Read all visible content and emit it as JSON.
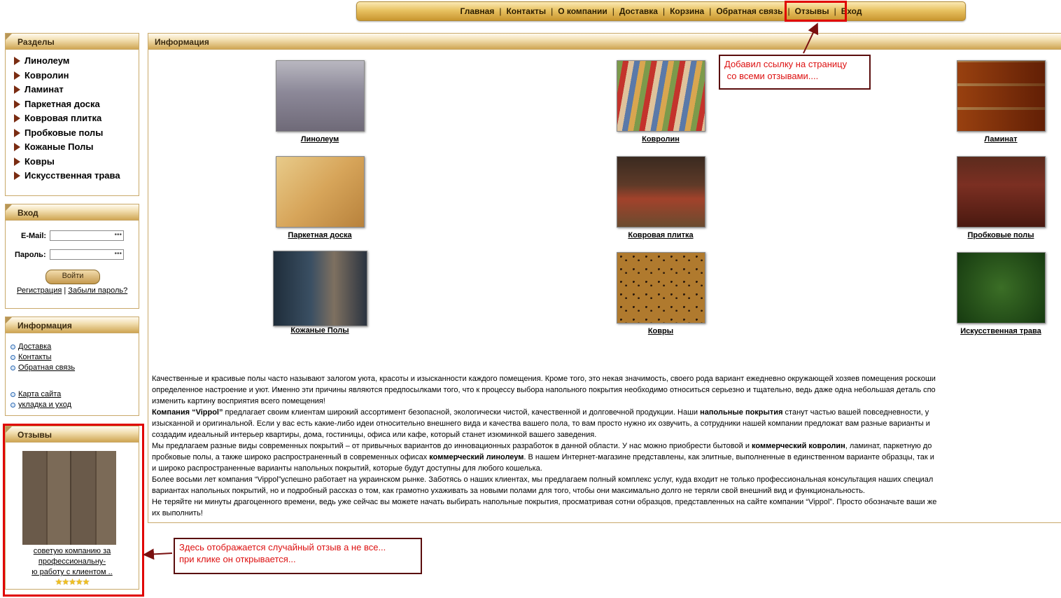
{
  "topnav": {
    "items": [
      "Главная",
      "Контакты",
      "О компании",
      "Доставка",
      "Корзина",
      "Обратная связь",
      "Отзывы",
      "Вход"
    ],
    "separator": "|"
  },
  "sidebar": {
    "sections": {
      "title": "Разделы",
      "items": [
        "Линолеум",
        "Ковролин",
        "Ламинат",
        "Паркетная доска",
        "Ковровая плитка",
        "Пробковые полы",
        "Кожаные Полы",
        "Ковры",
        "Искусственная трава"
      ]
    },
    "login": {
      "title": "Вход",
      "email_label": "E-Mail:",
      "password_label": "Пароль:",
      "email_value": "•••",
      "password_value": "•••",
      "button": "Войти",
      "register": "Регистрация",
      "divider": "|",
      "forgot": "Забыли пароль?"
    },
    "info": {
      "title": "Информация",
      "links": [
        "Доставка",
        "Контакты",
        "Обратная связь"
      ],
      "links2": [
        "Карта сайта",
        "укладка и уход"
      ]
    },
    "reviews": {
      "title": "Отзывы",
      "snippet_lines": [
        "советую компанию за",
        "профессиональну-",
        "ю работу с клиентом .."
      ],
      "stars": "★★★★★",
      "rating": 5
    }
  },
  "main": {
    "title": "Информация",
    "products": [
      "Линолеум",
      "Ковролин",
      "Ламинат",
      "Паркетная доска",
      "Ковровая плитка",
      "Пробковые полы",
      "Кожаные Полы",
      "Ковры",
      "Искусственная трава"
    ],
    "text": {
      "p1a": "Качественные и красивые полы часто называют залогом уюта, красоты и изысканности каждого помещения. Кроме того, это некая значимость, своего рода вариант ежедневно окружающей хозяев помещения роскоши",
      "p1b": "определенное настроение и уют. Именно эти причины являются предпосылками того, что к процессу выбора напольного покрытия необходимо относиться серьезно и тщательно, ведь даже одна небольшая деталь спо",
      "p1c": "изменить картину восприятия всего помещения!",
      "p2_bold1": "Компания “Vippol”",
      "p2a": " предлагает своим клиентам широкий ассортимент безопасной, экологически чистой, качественной и долговечной продукции. Наши ",
      "p2_bold2": "напольные покрытия",
      "p2b": " станут частью вашей повседневности, у",
      "p2c": "изысканной и оригинальной. Если у вас есть какие-либо идеи относительно внешнего вида и качества вашего пола, то вам просто нужно их озвучить, а сотрудники нашей компании предложат вам разные варианты и",
      "p2d": "создадим идеальный интерьер квартиры, дома, гостиницы, офиса или кафе, который станет изюминкой вашего заведения.",
      "p3a": "Мы предлагаем разные виды современных покрытий – от привычных вариантов до инновационных разработок в данной области. У нас можно приобрести бытовой и ",
      "p3_bold1": "коммерческий ковролин",
      "p3b": ", ламинат, паркетную до",
      "p3c": "пробковые полы, а также широко распространенный в современных офисах ",
      "p3_bold2": "коммерческий линолеум",
      "p3d": ". В нашем Интернет-магазине представлены, как элитные, выполненные в единственном варианте образцы, так и",
      "p3e": "и широко распространенные варианты напольных покрытий, которые будут доступны для любого кошелька.",
      "p4a": "Более восьми лет компания “Vippol”успешно работает на украинском рынке. Заботясь о наших клиентах, мы предлагаем полный комплекс услуг, куда входит не только профессиональная консультация наших специал",
      "p4b": "вариантах напольных покрытий, но и подробный рассказ о том, как грамотно ухаживать за новыми полами для того, чтобы они максимально долго не теряли свой внешний вид и функциональность.",
      "p5a": "Не теряйте ни минуты драгоценного времени, ведь уже сейчас вы можете начать выбирать напольные покрытия, просматривая сотни образцов, представленных на сайте компании “Vippol”. Просто обозначьте ваши же",
      "p5b": "их выполнить!"
    }
  },
  "annotations": {
    "top": [
      "Добавил ссылку на страницу",
      " со всеми отзывами...."
    ],
    "bottom": [
      "Здесь отображается случайный отзыв а не все...",
      "при клике он открывается..."
    ]
  },
  "colors": {
    "accent_gold": "#d9b25a",
    "annotation_red": "#e00000",
    "annotation_border": "#5a0d0d",
    "arrow": "#7a1010"
  }
}
